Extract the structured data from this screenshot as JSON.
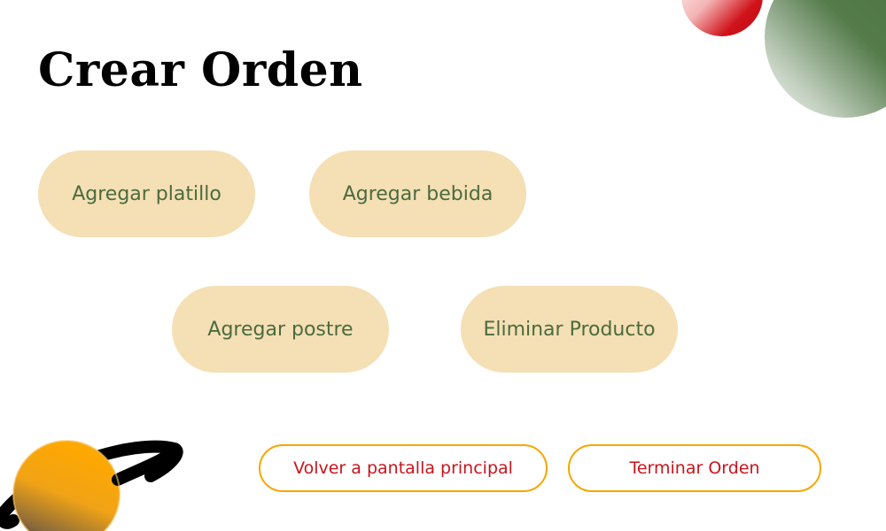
{
  "page": {
    "title": "Crear Orden"
  },
  "menu_buttons": {
    "add_dish": "Agregar platillo",
    "add_drink": "Agregar bebida",
    "add_dessert": "Agregar postre",
    "remove_product": "Eliminar Producto"
  },
  "footer": {
    "back_to_main": "Volver a pantalla principal",
    "finish_order": "Terminar Orden"
  },
  "colors": {
    "pill_background": "#f5dfb4",
    "pill_text": "#4a6b3f",
    "outline_border": "#f5a700",
    "outline_text": "#c8141c",
    "accent_red": "#d0121a",
    "accent_green": "#4f7a44",
    "accent_orange": "#ffa800"
  },
  "decorations": {
    "top_right": [
      "red-sphere-icon",
      "green-sphere-icon"
    ],
    "bottom_left": "saturn-planet-icon"
  }
}
